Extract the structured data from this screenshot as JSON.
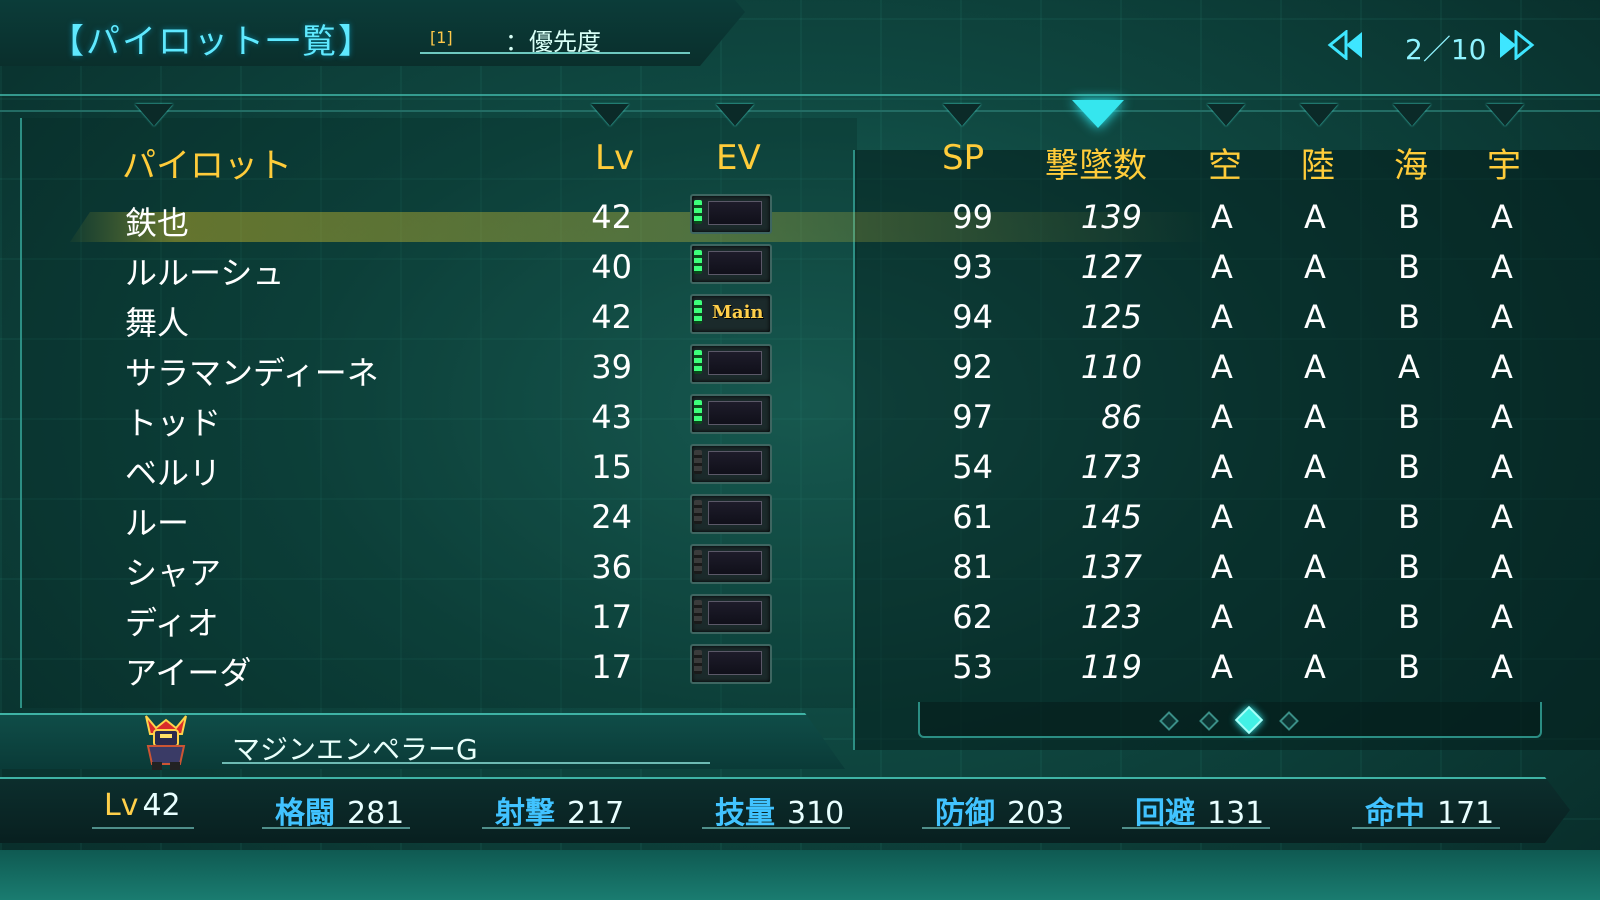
{
  "header": {
    "title": "【パイロット一覧】",
    "slot": "[1]",
    "sort_label": "：優先度"
  },
  "pager": {
    "text": "2／10"
  },
  "columns": {
    "pilot": "パイロット",
    "lv": "Lv",
    "ev": "EV",
    "sp": "SP",
    "kills": "撃墜数",
    "air": "空",
    "land": "陸",
    "sea": "海",
    "space": "宇"
  },
  "rows": [
    {
      "name": "鉄也",
      "lv": "42",
      "ev_on": true,
      "ev_main": "",
      "sp": "99",
      "kills": "139",
      "air": "A",
      "land": "A",
      "sea": "B",
      "space": "A",
      "selected": true
    },
    {
      "name": "ルルーシュ",
      "lv": "40",
      "ev_on": true,
      "ev_main": "",
      "sp": "93",
      "kills": "127",
      "air": "A",
      "land": "A",
      "sea": "B",
      "space": "A"
    },
    {
      "name": "舞人",
      "lv": "42",
      "ev_on": true,
      "ev_main": "Main",
      "sp": "94",
      "kills": "125",
      "air": "A",
      "land": "A",
      "sea": "B",
      "space": "A"
    },
    {
      "name": "サラマンディーネ",
      "lv": "39",
      "ev_on": true,
      "ev_main": "",
      "sp": "92",
      "kills": "110",
      "air": "A",
      "land": "A",
      "sea": "A",
      "space": "A"
    },
    {
      "name": "トッド",
      "lv": "43",
      "ev_on": true,
      "ev_main": "",
      "sp": "97",
      "kills": "86",
      "air": "A",
      "land": "A",
      "sea": "B",
      "space": "A"
    },
    {
      "name": "ベルリ",
      "lv": "15",
      "ev_on": false,
      "ev_main": "",
      "sp": "54",
      "kills": "173",
      "air": "A",
      "land": "A",
      "sea": "B",
      "space": "A"
    },
    {
      "name": "ルー",
      "lv": "24",
      "ev_on": false,
      "ev_main": "",
      "sp": "61",
      "kills": "145",
      "air": "A",
      "land": "A",
      "sea": "B",
      "space": "A"
    },
    {
      "name": "シャア",
      "lv": "36",
      "ev_on": false,
      "ev_main": "",
      "sp": "81",
      "kills": "137",
      "air": "A",
      "land": "A",
      "sea": "B",
      "space": "A"
    },
    {
      "name": "ディオ",
      "lv": "17",
      "ev_on": false,
      "ev_main": "",
      "sp": "62",
      "kills": "123",
      "air": "A",
      "land": "A",
      "sea": "B",
      "space": "A"
    },
    {
      "name": "アイーダ",
      "lv": "17",
      "ev_on": false,
      "ev_main": "",
      "sp": "53",
      "kills": "119",
      "air": "A",
      "land": "A",
      "sea": "B",
      "space": "A"
    }
  ],
  "page_dots": {
    "count": 4,
    "active": 3
  },
  "unit": {
    "name": "マジンエンペラーG"
  },
  "stats": {
    "lv_label": "Lv",
    "lv": "42",
    "melee_label": "格闘",
    "melee": "281",
    "ranged_label": "射撃",
    "ranged": "217",
    "skill_label": "技量",
    "skill": "310",
    "defense_label": "防御",
    "defense": "203",
    "evade_label": "回避",
    "evade": "131",
    "hit_label": "命中",
    "hit": "171"
  },
  "colors": {
    "accent": "#3ee6ff",
    "header_gold": "#ffcc3a",
    "stat_blue": "#41c3ff"
  }
}
